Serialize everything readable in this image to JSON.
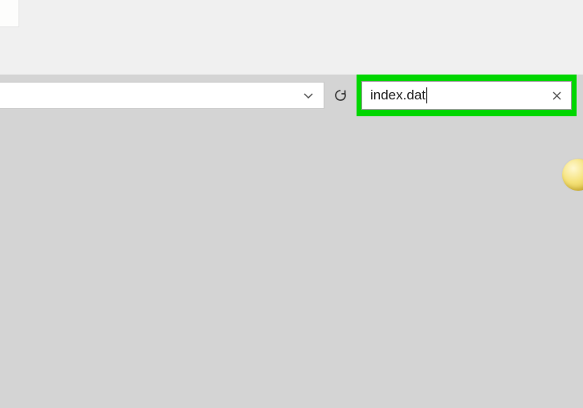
{
  "address_bar": {
    "path": "",
    "dropdown_icon": "chevron-down",
    "refresh_icon": "refresh"
  },
  "search": {
    "value": "index.dat",
    "placeholder": "",
    "clear_icon": "close"
  },
  "highlight_color": "#00d600"
}
